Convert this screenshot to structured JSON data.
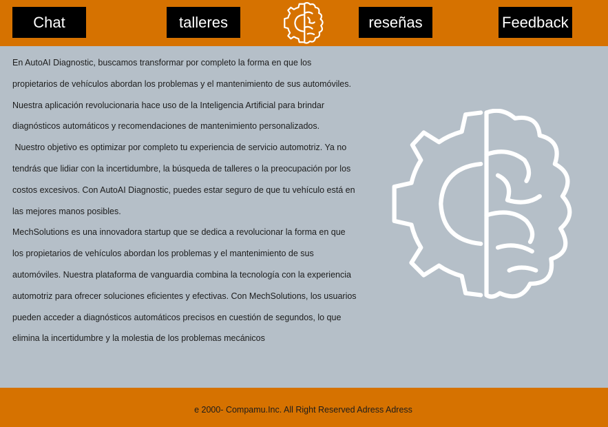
{
  "nav": {
    "chat_label": "Chat",
    "talleres_label": "talleres",
    "resenas_label": "reseñas",
    "feedback_label": "Feedback"
  },
  "logo": {
    "icon": "gear-brain-icon",
    "color": "#ffffff"
  },
  "content": {
    "paragraphs": [
      "En AutoAI Diagnostic, buscamos transformar por completo la forma en que los propietarios de vehículos abordan los problemas y el mantenimiento de sus automóviles. Nuestra aplicación revolucionaria hace uso de la Inteligencia Artificial para brindar diagnósticos automáticos y recomendaciones de mantenimiento personalizados.",
      " Nuestro objetivo es optimizar por completo tu experiencia de servicio automotriz. Ya no tendrás que lidiar con la incertidumbre, la búsqueda de talleres o la preocupación por los costos excesivos. Con AutoAI Diagnostic, puedes estar seguro de que tu vehículo está en las mejores manos posibles.",
      "MechSolutions es una innovadora startup que se dedica a revolucionar la forma en que los propietarios de vehículos abordan los problemas y el mantenimiento de sus automóviles. Nuestra plataforma de vanguardia combina la tecnología con la experiencia automotriz para ofrecer soluciones eficientes y efectivas. Con MechSolutions, los usuarios pueden acceder a diagnósticos automáticos precisos en cuestión de segundos, lo que elimina la incertidumbre y la molestia de los problemas mecánicos"
    ]
  },
  "footer": {
    "text": "e 2000- Compamu.Inc. All Right Reserved Adress Adress"
  },
  "colors": {
    "accent": "#d67200",
    "background": "#b5bfc8",
    "button": "#000000"
  }
}
